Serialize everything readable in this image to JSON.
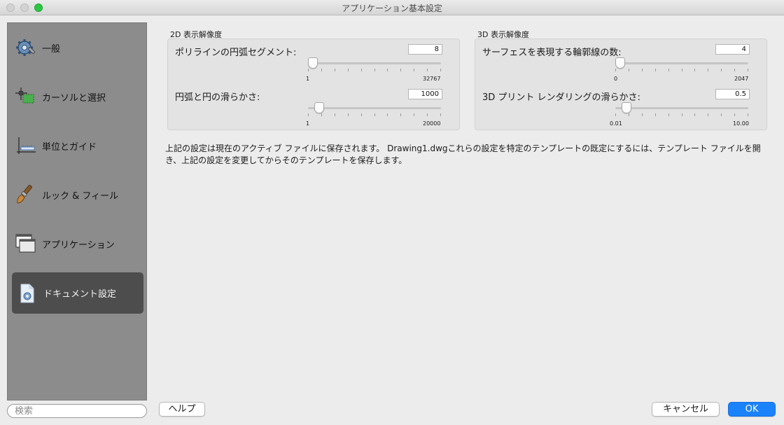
{
  "window": {
    "title": "アプリケーション基本設定"
  },
  "sidebar": {
    "items": [
      {
        "label": "一般",
        "icon": "gear-wrench-icon"
      },
      {
        "label": "カーソルと選択",
        "icon": "crosshair-selection-icon"
      },
      {
        "label": "単位とガイド",
        "icon": "units-guides-icon"
      },
      {
        "label": "ルック & フィール",
        "icon": "paintbrush-icon"
      },
      {
        "label": "アプリケーション",
        "icon": "windows-icon"
      },
      {
        "label": "ドキュメント設定",
        "icon": "document-icon",
        "active": true
      }
    ],
    "search_placeholder": "検索"
  },
  "groups": [
    {
      "title": "2D 表示解像度",
      "rows": [
        {
          "label": "ポリラインの円弧セグメント:",
          "value": "8",
          "min": "1",
          "max": "32767",
          "fraction": 0.0
        },
        {
          "label": "円弧と円の滑らかさ:",
          "value": "1000",
          "min": "1",
          "max": "20000",
          "fraction": 0.05
        }
      ]
    },
    {
      "title": "3D 表示解像度",
      "rows": [
        {
          "label": "サーフェスを表現する輪郭線の数:",
          "value": "4",
          "min": "0",
          "max": "2047",
          "fraction": 0.0
        },
        {
          "label": "3D プリント レンダリングの滑らかさ:",
          "value": "0.5",
          "min": "0.01",
          "max": "10.00",
          "fraction": 0.05
        }
      ]
    }
  ],
  "info_text": "上記の設定は現在のアクティブ ファイルに保存されます。 Drawing1.dwgこれらの設定を特定のテンプレートの既定にするには、テンプレート ファイルを開き、上記の設定を変更してからそのテンプレートを保存します。",
  "buttons": {
    "help": "ヘルプ",
    "cancel": "キャンセル",
    "ok": "OK"
  },
  "colors": {
    "accent": "#1a82fb",
    "sidebar_bg": "#8c8c8c",
    "sidebar_active": "#4d4d4d"
  }
}
